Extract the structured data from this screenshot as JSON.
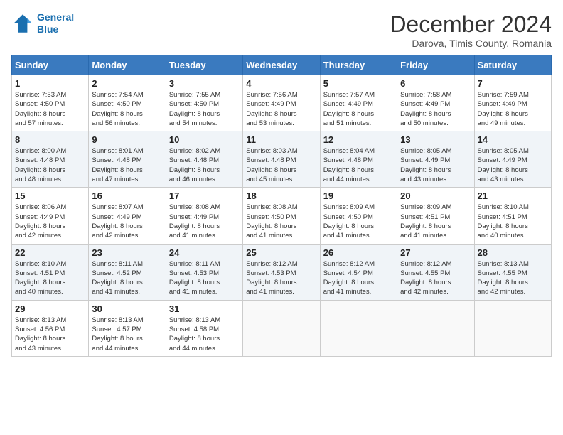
{
  "logo": {
    "line1": "General",
    "line2": "Blue"
  },
  "title": "December 2024",
  "subtitle": "Darova, Timis County, Romania",
  "days_header": [
    "Sunday",
    "Monday",
    "Tuesday",
    "Wednesday",
    "Thursday",
    "Friday",
    "Saturday"
  ],
  "weeks": [
    [
      {
        "day": "1",
        "info": "Sunrise: 7:53 AM\nSunset: 4:50 PM\nDaylight: 8 hours\nand 57 minutes."
      },
      {
        "day": "2",
        "info": "Sunrise: 7:54 AM\nSunset: 4:50 PM\nDaylight: 8 hours\nand 56 minutes."
      },
      {
        "day": "3",
        "info": "Sunrise: 7:55 AM\nSunset: 4:50 PM\nDaylight: 8 hours\nand 54 minutes."
      },
      {
        "day": "4",
        "info": "Sunrise: 7:56 AM\nSunset: 4:49 PM\nDaylight: 8 hours\nand 53 minutes."
      },
      {
        "day": "5",
        "info": "Sunrise: 7:57 AM\nSunset: 4:49 PM\nDaylight: 8 hours\nand 51 minutes."
      },
      {
        "day": "6",
        "info": "Sunrise: 7:58 AM\nSunset: 4:49 PM\nDaylight: 8 hours\nand 50 minutes."
      },
      {
        "day": "7",
        "info": "Sunrise: 7:59 AM\nSunset: 4:49 PM\nDaylight: 8 hours\nand 49 minutes."
      }
    ],
    [
      {
        "day": "8",
        "info": "Sunrise: 8:00 AM\nSunset: 4:48 PM\nDaylight: 8 hours\nand 48 minutes."
      },
      {
        "day": "9",
        "info": "Sunrise: 8:01 AM\nSunset: 4:48 PM\nDaylight: 8 hours\nand 47 minutes."
      },
      {
        "day": "10",
        "info": "Sunrise: 8:02 AM\nSunset: 4:48 PM\nDaylight: 8 hours\nand 46 minutes."
      },
      {
        "day": "11",
        "info": "Sunrise: 8:03 AM\nSunset: 4:48 PM\nDaylight: 8 hours\nand 45 minutes."
      },
      {
        "day": "12",
        "info": "Sunrise: 8:04 AM\nSunset: 4:48 PM\nDaylight: 8 hours\nand 44 minutes."
      },
      {
        "day": "13",
        "info": "Sunrise: 8:05 AM\nSunset: 4:49 PM\nDaylight: 8 hours\nand 43 minutes."
      },
      {
        "day": "14",
        "info": "Sunrise: 8:05 AM\nSunset: 4:49 PM\nDaylight: 8 hours\nand 43 minutes."
      }
    ],
    [
      {
        "day": "15",
        "info": "Sunrise: 8:06 AM\nSunset: 4:49 PM\nDaylight: 8 hours\nand 42 minutes."
      },
      {
        "day": "16",
        "info": "Sunrise: 8:07 AM\nSunset: 4:49 PM\nDaylight: 8 hours\nand 42 minutes."
      },
      {
        "day": "17",
        "info": "Sunrise: 8:08 AM\nSunset: 4:49 PM\nDaylight: 8 hours\nand 41 minutes."
      },
      {
        "day": "18",
        "info": "Sunrise: 8:08 AM\nSunset: 4:50 PM\nDaylight: 8 hours\nand 41 minutes."
      },
      {
        "day": "19",
        "info": "Sunrise: 8:09 AM\nSunset: 4:50 PM\nDaylight: 8 hours\nand 41 minutes."
      },
      {
        "day": "20",
        "info": "Sunrise: 8:09 AM\nSunset: 4:51 PM\nDaylight: 8 hours\nand 41 minutes."
      },
      {
        "day": "21",
        "info": "Sunrise: 8:10 AM\nSunset: 4:51 PM\nDaylight: 8 hours\nand 40 minutes."
      }
    ],
    [
      {
        "day": "22",
        "info": "Sunrise: 8:10 AM\nSunset: 4:51 PM\nDaylight: 8 hours\nand 40 minutes."
      },
      {
        "day": "23",
        "info": "Sunrise: 8:11 AM\nSunset: 4:52 PM\nDaylight: 8 hours\nand 41 minutes."
      },
      {
        "day": "24",
        "info": "Sunrise: 8:11 AM\nSunset: 4:53 PM\nDaylight: 8 hours\nand 41 minutes."
      },
      {
        "day": "25",
        "info": "Sunrise: 8:12 AM\nSunset: 4:53 PM\nDaylight: 8 hours\nand 41 minutes."
      },
      {
        "day": "26",
        "info": "Sunrise: 8:12 AM\nSunset: 4:54 PM\nDaylight: 8 hours\nand 41 minutes."
      },
      {
        "day": "27",
        "info": "Sunrise: 8:12 AM\nSunset: 4:55 PM\nDaylight: 8 hours\nand 42 minutes."
      },
      {
        "day": "28",
        "info": "Sunrise: 8:13 AM\nSunset: 4:55 PM\nDaylight: 8 hours\nand 42 minutes."
      }
    ],
    [
      {
        "day": "29",
        "info": "Sunrise: 8:13 AM\nSunset: 4:56 PM\nDaylight: 8 hours\nand 43 minutes."
      },
      {
        "day": "30",
        "info": "Sunrise: 8:13 AM\nSunset: 4:57 PM\nDaylight: 8 hours\nand 44 minutes."
      },
      {
        "day": "31",
        "info": "Sunrise: 8:13 AM\nSunset: 4:58 PM\nDaylight: 8 hours\nand 44 minutes."
      },
      null,
      null,
      null,
      null
    ]
  ]
}
